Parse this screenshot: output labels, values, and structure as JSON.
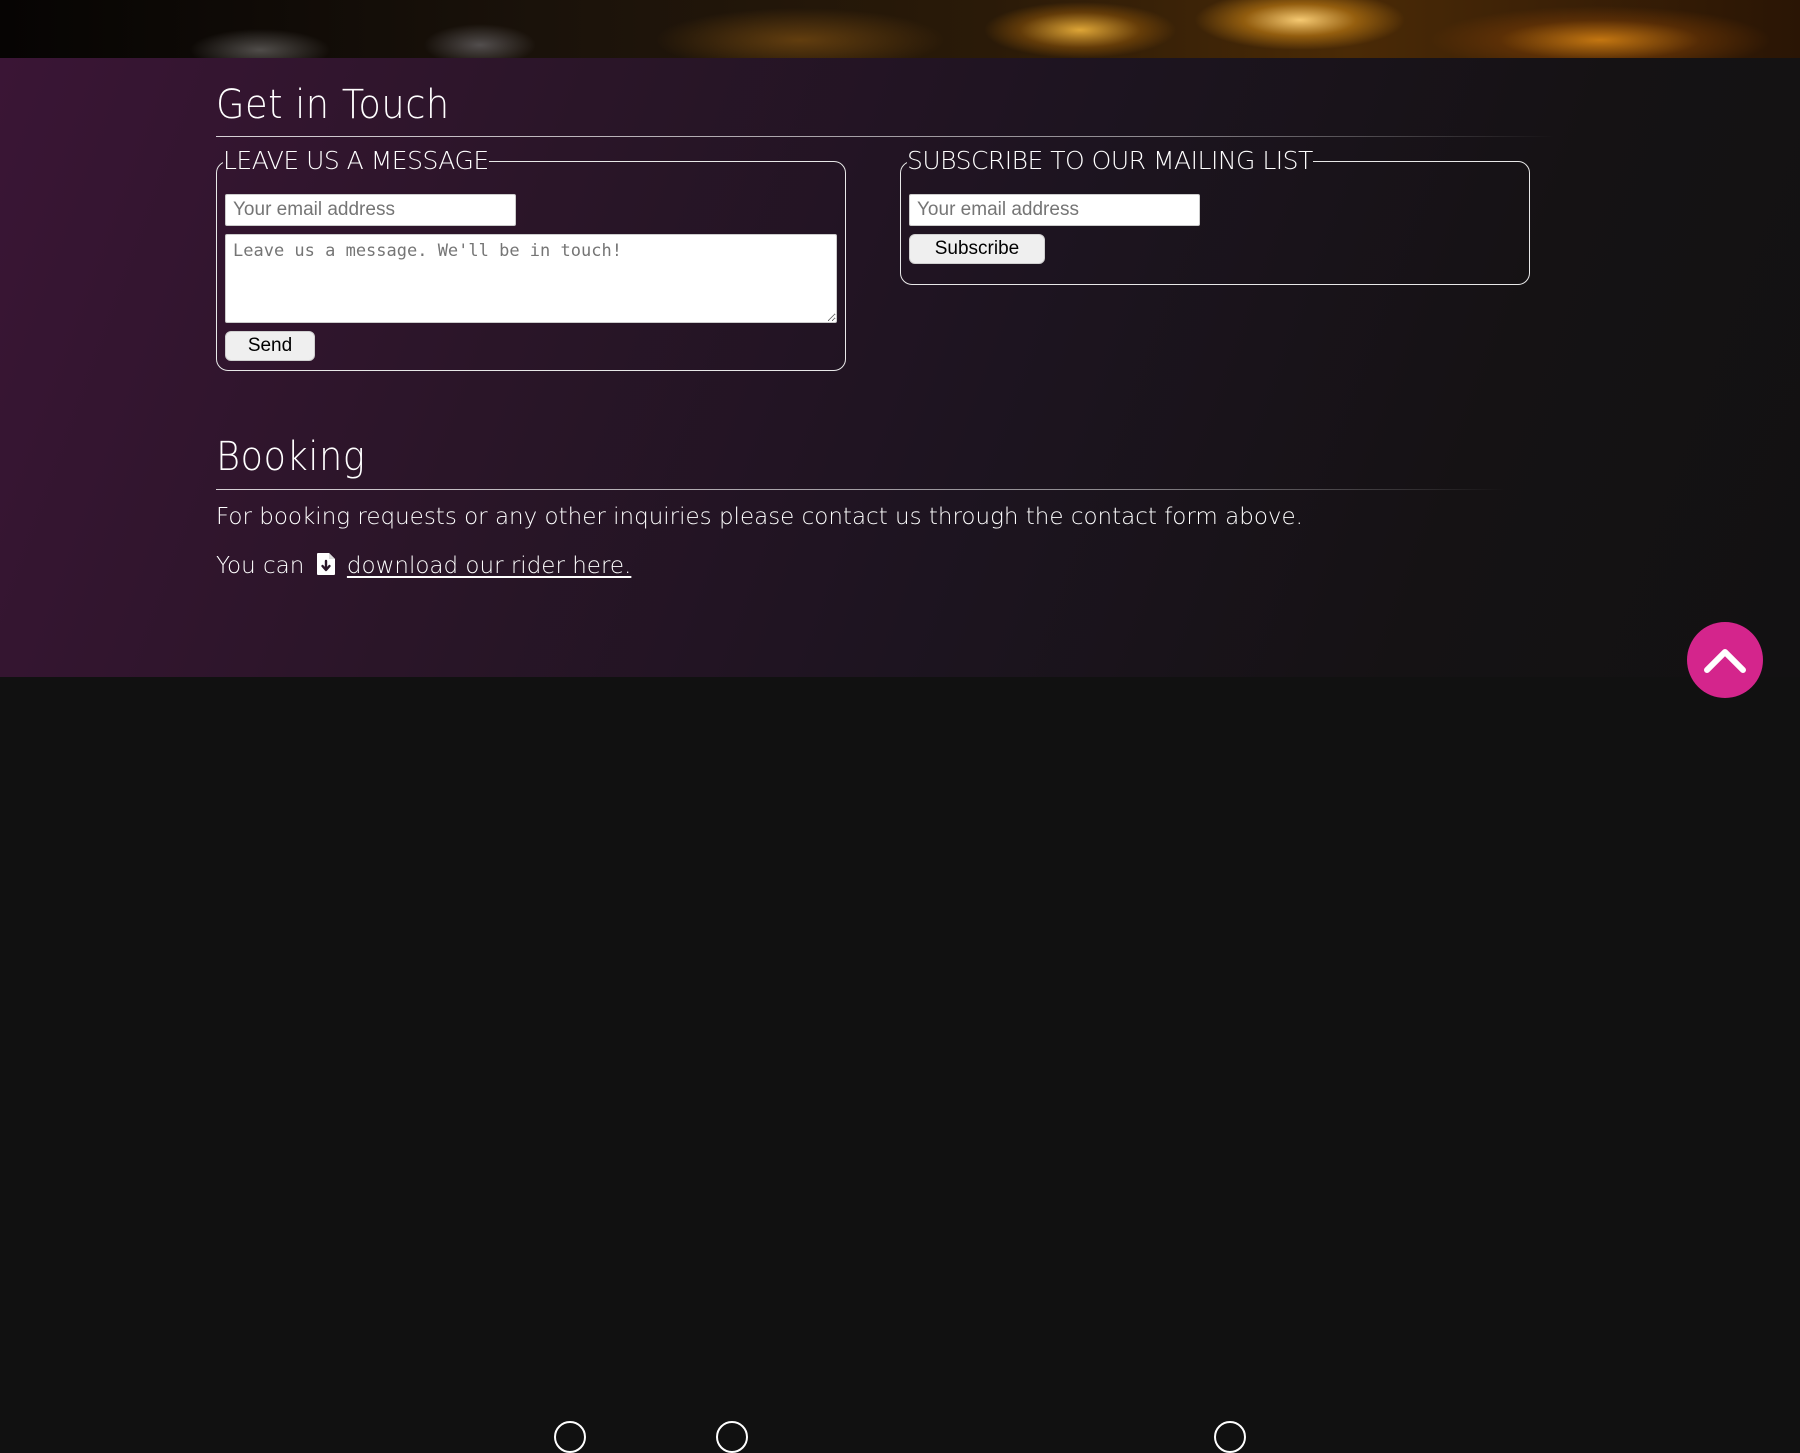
{
  "contact": {
    "heading": "Get in Touch",
    "message_form": {
      "legend": "LEAVE US A MESSAGE",
      "email_placeholder": "Your email address",
      "message_placeholder": "Leave us a message. We'll be in touch!",
      "send_label": "Send"
    },
    "subscribe_form": {
      "legend": "SUBSCRIBE TO OUR MAILING LIST",
      "email_placeholder": "Your email address",
      "subscribe_label": "Subscribe"
    }
  },
  "booking": {
    "heading": "Booking",
    "text": "For booking requests or any other inquiries please contact us through the contact form above.",
    "rider_prefix": "You can",
    "rider_link": "download our rider here.",
    "rider_icon": "file-download-icon"
  },
  "scroll_top": {
    "icon": "chevron-up-icon"
  },
  "colors": {
    "accent": "#d4258c",
    "section_bg_start": "#3a1535",
    "section_bg_end": "#121112",
    "footer_bg": "#111111"
  }
}
